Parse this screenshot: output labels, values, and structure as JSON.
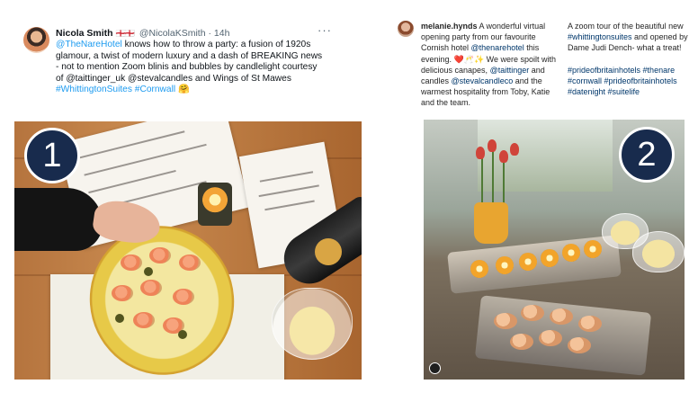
{
  "tweet": {
    "name": "Nicola Smith",
    "flags": "🏴󠁧󠁢󠁥󠁮󠁧󠁿🏴󠁧󠁢󠁥󠁮󠁧󠁿",
    "handle": "@NicolaKSmith",
    "dot": "·",
    "time": "14h",
    "more": "···",
    "body": {
      "mention1": "@TheNareHotel",
      "text1": " knows how to throw a party: a fusion of 1920s glamour, a twist of modern luxury and a dash of BREAKING news - not to mention Zoom blinis and bubbles by candlelight courtesy of @taittinger_uk @stevalcandles and Wings of St Mawes ",
      "hashtag1": "#WhittingtonSuites",
      "hashtag2": "#Cornwall",
      "emoji": "🤗"
    }
  },
  "photo1": {
    "badge": "1"
  },
  "instagram": {
    "user": "melanie.hynds",
    "text1": " A wonderful virtual opening party from our favourite Cornish hotel ",
    "mention1": "@thenarehotel",
    "text2": " this evening. ❤️🥂✨ We were spoilt with delicious canapes, ",
    "mention2": "@taittinger",
    "text3": " and candles ",
    "mention3": "@stevalcandleco",
    "text4": " and the warmest hospitality from Toby, Katie and the team.",
    "col2_text1": "A zoom tour of the beautiful new ",
    "col2_hashtag1": "#whittingtonsuites",
    "col2_text2": " and opened by Dame Judi Dench- what a treat!",
    "tags": "#prideofbritainhotels #thenare #cornwall #prideofbritainhotels #datenight #suitelife"
  },
  "photo2": {
    "badge": "2"
  },
  "colors": {
    "link_twitter": "#1d9bf0",
    "link_instagram": "#00376b",
    "badge_bg": "#182b4d"
  }
}
